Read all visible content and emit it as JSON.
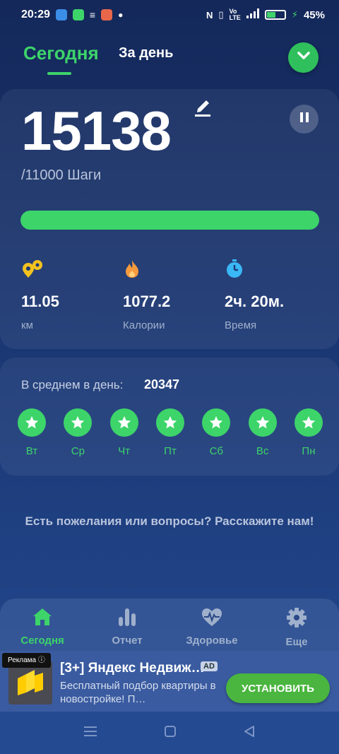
{
  "status_bar": {
    "time": "20:29",
    "battery": "45%",
    "battery_level": 0.45
  },
  "header": {
    "tab_today": "Сегодня",
    "tab_day": "За день"
  },
  "steps": {
    "value": "15138",
    "goal": "/11000 Шаги",
    "progress": 1.0
  },
  "stats": [
    {
      "icon": "distance-icon",
      "value": "11.05",
      "label": "км"
    },
    {
      "icon": "flame-icon",
      "value": "1077.2",
      "label": "Калории"
    },
    {
      "icon": "stopwatch-icon",
      "value": "2ч. 20м.",
      "label": "Время"
    }
  ],
  "weekly": {
    "avg_label": "В среднем в день:",
    "avg_value": "20347",
    "days": [
      "Вт",
      "Ср",
      "Чт",
      "Пт",
      "Сб",
      "Вс",
      "Пн"
    ]
  },
  "feedback": "Есть пожелания или вопросы? Расскажите нам!",
  "bottom_nav": [
    {
      "icon": "home-icon",
      "label": "Сегодня",
      "active": true
    },
    {
      "icon": "chart-icon",
      "label": "Отчет",
      "active": false
    },
    {
      "icon": "heart-pulse-icon",
      "label": "Здоровье",
      "active": false
    },
    {
      "icon": "gear-icon",
      "label": "Еще",
      "active": false
    }
  ],
  "ad": {
    "badge": "Реклама",
    "title": "[3+] Яндекс Недвиж…",
    "mark": "AD",
    "description": "Бесплатный подбор квартиры в новостройке! П…",
    "install": "УСТАНОВИТЬ"
  },
  "colors": {
    "accent": "#3dd46a",
    "background": "#1c3a78"
  }
}
